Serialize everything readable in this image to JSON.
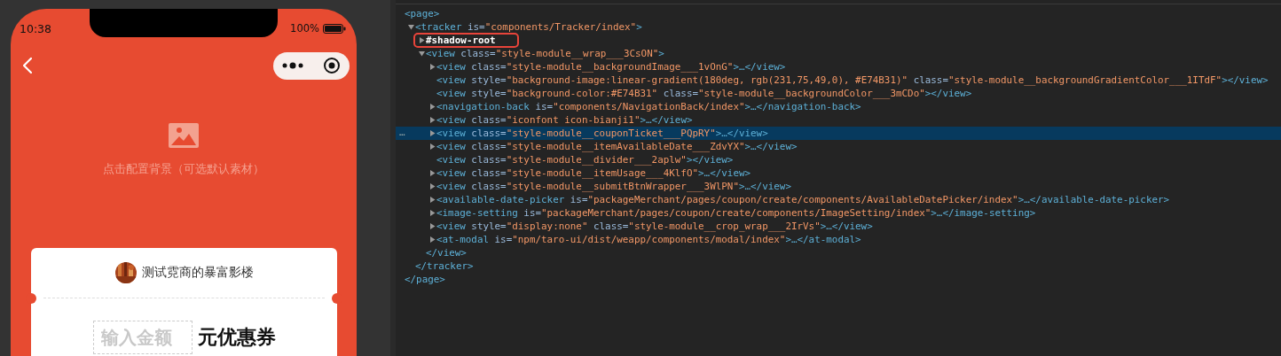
{
  "phone": {
    "status_bar": {
      "time": "10:38",
      "battery": "100%"
    },
    "background_hint": {
      "text": "点击配置背景（可选默认素材）"
    },
    "coupon": {
      "shop_name": "测试霓商的暴富影楼",
      "amount_field": {
        "placeholder": "输入金额"
      },
      "unit": "元优惠券"
    }
  },
  "dom_tree": {
    "nodes": [
      {
        "kind": "root",
        "selected": false,
        "annotated": false,
        "tokens": [
          {
            "kind": "tag",
            "text": "<page>"
          }
        ],
        "closing": [
          {
            "kind": "tag",
            "text": "</page>"
          }
        ],
        "children": [
          {
            "kind": "branch",
            "expanded": true,
            "selected": false,
            "annotated": false,
            "tokens": [
              {
                "kind": "tag",
                "text": "<tracker"
              },
              {
                "kind": "attr",
                "text": "is="
              },
              {
                "kind": "value",
                "text": "\"components/Tracker/index\""
              },
              {
                "kind": "tag",
                "text": ">"
              }
            ],
            "closing": [
              {
                "kind": "tag",
                "text": "</tracker>"
              }
            ],
            "children": [
              {
                "kind": "branch",
                "expanded": false,
                "selected": false,
                "annotated": true,
                "tokens": [
                  {
                    "kind": "text",
                    "text": "#shadow-root"
                  }
                ]
              },
              {
                "kind": "branch",
                "expanded": true,
                "selected": false,
                "annotated": false,
                "tokens": [
                  {
                    "kind": "tag",
                    "text": "<view"
                  },
                  {
                    "kind": "attr",
                    "text": "class="
                  },
                  {
                    "kind": "value",
                    "text": "\"style-module__wrap___3CsON\""
                  },
                  {
                    "kind": "tag",
                    "text": ">"
                  }
                ],
                "closing": [
                  {
                    "kind": "tag",
                    "text": "</view>"
                  }
                ],
                "children": [
                  {
                    "kind": "branch",
                    "expanded": false,
                    "selected": false,
                    "annotated": false,
                    "tokens": [
                      {
                        "kind": "tag",
                        "text": "<view"
                      },
                      {
                        "kind": "attr",
                        "text": "class="
                      },
                      {
                        "kind": "value",
                        "text": "\"style-module__backgroundImage___1vOnG\""
                      },
                      {
                        "kind": "tag",
                        "text": ">…</view>"
                      }
                    ]
                  },
                  {
                    "kind": "leaf",
                    "selected": false,
                    "annotated": false,
                    "tokens": [
                      {
                        "kind": "tag",
                        "text": "<view"
                      },
                      {
                        "kind": "attr",
                        "text": "style="
                      },
                      {
                        "kind": "value",
                        "text": "\"background-image:linear-gradient(180deg, rgb(231,75,49,0), #E74B31)\""
                      },
                      {
                        "kind": "attr",
                        "text": "class="
                      },
                      {
                        "kind": "value",
                        "text": "\"style-module__backgroundGradientColor___1ITdF\""
                      },
                      {
                        "kind": "tag",
                        "text": "></view>"
                      }
                    ]
                  },
                  {
                    "kind": "leaf",
                    "selected": false,
                    "annotated": false,
                    "tokens": [
                      {
                        "kind": "tag",
                        "text": "<view"
                      },
                      {
                        "kind": "attr",
                        "text": "style="
                      },
                      {
                        "kind": "value",
                        "text": "\"background-color:#E74B31\""
                      },
                      {
                        "kind": "attr",
                        "text": "class="
                      },
                      {
                        "kind": "value",
                        "text": "\"style-module__backgroundColor___3mCDo\""
                      },
                      {
                        "kind": "tag",
                        "text": "></view>"
                      }
                    ]
                  },
                  {
                    "kind": "branch",
                    "expanded": false,
                    "selected": false,
                    "annotated": false,
                    "tokens": [
                      {
                        "kind": "tag",
                        "text": "<navigation-back"
                      },
                      {
                        "kind": "attr",
                        "text": "is="
                      },
                      {
                        "kind": "value",
                        "text": "\"components/NavigationBack/index\""
                      },
                      {
                        "kind": "tag",
                        "text": ">…</navigation-back>"
                      }
                    ]
                  },
                  {
                    "kind": "branch",
                    "expanded": false,
                    "selected": false,
                    "annotated": false,
                    "tokens": [
                      {
                        "kind": "tag",
                        "text": "<view"
                      },
                      {
                        "kind": "attr",
                        "text": "class="
                      },
                      {
                        "kind": "value",
                        "text": "\"iconfont icon-bianji1\""
                      },
                      {
                        "kind": "tag",
                        "text": ">…</view>"
                      }
                    ]
                  },
                  {
                    "kind": "branch",
                    "expanded": false,
                    "selected": true,
                    "annotated": false,
                    "gutter": "…",
                    "tokens": [
                      {
                        "kind": "tag",
                        "text": "<view"
                      },
                      {
                        "kind": "attr",
                        "text": "class="
                      },
                      {
                        "kind": "value",
                        "text": "\"style-module__couponTicket___PQpRY\""
                      },
                      {
                        "kind": "tag",
                        "text": ">…</view>"
                      }
                    ]
                  },
                  {
                    "kind": "branch",
                    "expanded": false,
                    "selected": false,
                    "annotated": false,
                    "tokens": [
                      {
                        "kind": "tag",
                        "text": "<view"
                      },
                      {
                        "kind": "attr",
                        "text": "class="
                      },
                      {
                        "kind": "value",
                        "text": "\"style-module__itemAvailableDate___ZdvYX\""
                      },
                      {
                        "kind": "tag",
                        "text": ">…</view>"
                      }
                    ]
                  },
                  {
                    "kind": "leaf",
                    "selected": false,
                    "annotated": false,
                    "tokens": [
                      {
                        "kind": "tag",
                        "text": "<view"
                      },
                      {
                        "kind": "attr",
                        "text": "class="
                      },
                      {
                        "kind": "value",
                        "text": "\"style-module__divider___2aplw\""
                      },
                      {
                        "kind": "tag",
                        "text": "></view>"
                      }
                    ]
                  },
                  {
                    "kind": "branch",
                    "expanded": false,
                    "selected": false,
                    "annotated": false,
                    "tokens": [
                      {
                        "kind": "tag",
                        "text": "<view"
                      },
                      {
                        "kind": "attr",
                        "text": "class="
                      },
                      {
                        "kind": "value",
                        "text": "\"style-module__itemUsage___4KlfO\""
                      },
                      {
                        "kind": "tag",
                        "text": ">…</view>"
                      }
                    ]
                  },
                  {
                    "kind": "branch",
                    "expanded": false,
                    "selected": false,
                    "annotated": false,
                    "tokens": [
                      {
                        "kind": "tag",
                        "text": "<view"
                      },
                      {
                        "kind": "attr",
                        "text": "class="
                      },
                      {
                        "kind": "value",
                        "text": "\"style-module__submitBtnWrapper___3WlPN\""
                      },
                      {
                        "kind": "tag",
                        "text": ">…</view>"
                      }
                    ]
                  },
                  {
                    "kind": "branch",
                    "expanded": false,
                    "selected": false,
                    "annotated": false,
                    "tokens": [
                      {
                        "kind": "tag",
                        "text": "<available-date-picker"
                      },
                      {
                        "kind": "attr",
                        "text": "is="
                      },
                      {
                        "kind": "value",
                        "text": "\"packageMerchant/pages/coupon/create/components/AvailableDatePicker/index\""
                      },
                      {
                        "kind": "tag",
                        "text": ">…</available-date-picker>"
                      }
                    ]
                  },
                  {
                    "kind": "branch",
                    "expanded": false,
                    "selected": false,
                    "annotated": false,
                    "tokens": [
                      {
                        "kind": "tag",
                        "text": "<image-setting"
                      },
                      {
                        "kind": "attr",
                        "text": "is="
                      },
                      {
                        "kind": "value",
                        "text": "\"packageMerchant/pages/coupon/create/components/ImageSetting/index\""
                      },
                      {
                        "kind": "tag",
                        "text": ">…</image-setting>"
                      }
                    ]
                  },
                  {
                    "kind": "branch",
                    "expanded": false,
                    "selected": false,
                    "annotated": false,
                    "tokens": [
                      {
                        "kind": "tag",
                        "text": "<view"
                      },
                      {
                        "kind": "attr",
                        "text": "style="
                      },
                      {
                        "kind": "value",
                        "text": "\"display:none\""
                      },
                      {
                        "kind": "attr",
                        "text": "class="
                      },
                      {
                        "kind": "value",
                        "text": "\"style-module__crop_wrap___2IrVs\""
                      },
                      {
                        "kind": "tag",
                        "text": ">…</view>"
                      }
                    ]
                  },
                  {
                    "kind": "branch",
                    "expanded": false,
                    "selected": false,
                    "annotated": false,
                    "tokens": [
                      {
                        "kind": "tag",
                        "text": "<at-modal"
                      },
                      {
                        "kind": "attr",
                        "text": "is="
                      },
                      {
                        "kind": "value",
                        "text": "\"npm/taro-ui/dist/weapp/components/modal/index\""
                      },
                      {
                        "kind": "tag",
                        "text": ">…</at-modal>"
                      }
                    ]
                  }
                ]
              }
            ]
          }
        ]
      }
    ]
  }
}
